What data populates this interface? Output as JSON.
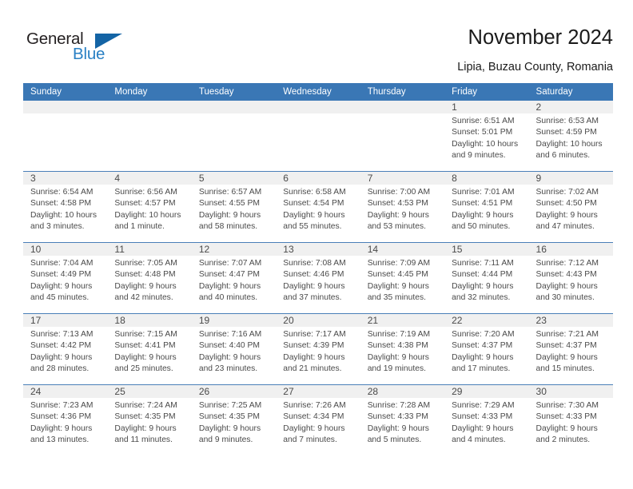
{
  "logo": {
    "word1": "General",
    "word2": "Blue",
    "flag_icon": "triangle-flag-icon",
    "accent_color": "#1464a5",
    "text_color": "#2980c4"
  },
  "header": {
    "title": "November 2024",
    "subtitle": "Lipia, Buzau County, Romania"
  },
  "calendar": {
    "header_bg": "#3a77b5",
    "header_text_color": "#ffffff",
    "datestrip_bg": "#f0f0f0",
    "cell_bg": "#ffffff",
    "grid_line_color": "#4a7fb8",
    "weekdays": [
      "Sunday",
      "Monday",
      "Tuesday",
      "Wednesday",
      "Thursday",
      "Friday",
      "Saturday"
    ],
    "weeks": [
      [
        {
          "day": "",
          "lines": []
        },
        {
          "day": "",
          "lines": []
        },
        {
          "day": "",
          "lines": []
        },
        {
          "day": "",
          "lines": []
        },
        {
          "day": "",
          "lines": []
        },
        {
          "day": "1",
          "lines": [
            "Sunrise: 6:51 AM",
            "Sunset: 5:01 PM",
            "Daylight: 10 hours",
            "and 9 minutes."
          ]
        },
        {
          "day": "2",
          "lines": [
            "Sunrise: 6:53 AM",
            "Sunset: 4:59 PM",
            "Daylight: 10 hours",
            "and 6 minutes."
          ]
        }
      ],
      [
        {
          "day": "3",
          "lines": [
            "Sunrise: 6:54 AM",
            "Sunset: 4:58 PM",
            "Daylight: 10 hours",
            "and 3 minutes."
          ]
        },
        {
          "day": "4",
          "lines": [
            "Sunrise: 6:56 AM",
            "Sunset: 4:57 PM",
            "Daylight: 10 hours",
            "and 1 minute."
          ]
        },
        {
          "day": "5",
          "lines": [
            "Sunrise: 6:57 AM",
            "Sunset: 4:55 PM",
            "Daylight: 9 hours",
            "and 58 minutes."
          ]
        },
        {
          "day": "6",
          "lines": [
            "Sunrise: 6:58 AM",
            "Sunset: 4:54 PM",
            "Daylight: 9 hours",
            "and 55 minutes."
          ]
        },
        {
          "day": "7",
          "lines": [
            "Sunrise: 7:00 AM",
            "Sunset: 4:53 PM",
            "Daylight: 9 hours",
            "and 53 minutes."
          ]
        },
        {
          "day": "8",
          "lines": [
            "Sunrise: 7:01 AM",
            "Sunset: 4:51 PM",
            "Daylight: 9 hours",
            "and 50 minutes."
          ]
        },
        {
          "day": "9",
          "lines": [
            "Sunrise: 7:02 AM",
            "Sunset: 4:50 PM",
            "Daylight: 9 hours",
            "and 47 minutes."
          ]
        }
      ],
      [
        {
          "day": "10",
          "lines": [
            "Sunrise: 7:04 AM",
            "Sunset: 4:49 PM",
            "Daylight: 9 hours",
            "and 45 minutes."
          ]
        },
        {
          "day": "11",
          "lines": [
            "Sunrise: 7:05 AM",
            "Sunset: 4:48 PM",
            "Daylight: 9 hours",
            "and 42 minutes."
          ]
        },
        {
          "day": "12",
          "lines": [
            "Sunrise: 7:07 AM",
            "Sunset: 4:47 PM",
            "Daylight: 9 hours",
            "and 40 minutes."
          ]
        },
        {
          "day": "13",
          "lines": [
            "Sunrise: 7:08 AM",
            "Sunset: 4:46 PM",
            "Daylight: 9 hours",
            "and 37 minutes."
          ]
        },
        {
          "day": "14",
          "lines": [
            "Sunrise: 7:09 AM",
            "Sunset: 4:45 PM",
            "Daylight: 9 hours",
            "and 35 minutes."
          ]
        },
        {
          "day": "15",
          "lines": [
            "Sunrise: 7:11 AM",
            "Sunset: 4:44 PM",
            "Daylight: 9 hours",
            "and 32 minutes."
          ]
        },
        {
          "day": "16",
          "lines": [
            "Sunrise: 7:12 AM",
            "Sunset: 4:43 PM",
            "Daylight: 9 hours",
            "and 30 minutes."
          ]
        }
      ],
      [
        {
          "day": "17",
          "lines": [
            "Sunrise: 7:13 AM",
            "Sunset: 4:42 PM",
            "Daylight: 9 hours",
            "and 28 minutes."
          ]
        },
        {
          "day": "18",
          "lines": [
            "Sunrise: 7:15 AM",
            "Sunset: 4:41 PM",
            "Daylight: 9 hours",
            "and 25 minutes."
          ]
        },
        {
          "day": "19",
          "lines": [
            "Sunrise: 7:16 AM",
            "Sunset: 4:40 PM",
            "Daylight: 9 hours",
            "and 23 minutes."
          ]
        },
        {
          "day": "20",
          "lines": [
            "Sunrise: 7:17 AM",
            "Sunset: 4:39 PM",
            "Daylight: 9 hours",
            "and 21 minutes."
          ]
        },
        {
          "day": "21",
          "lines": [
            "Sunrise: 7:19 AM",
            "Sunset: 4:38 PM",
            "Daylight: 9 hours",
            "and 19 minutes."
          ]
        },
        {
          "day": "22",
          "lines": [
            "Sunrise: 7:20 AM",
            "Sunset: 4:37 PM",
            "Daylight: 9 hours",
            "and 17 minutes."
          ]
        },
        {
          "day": "23",
          "lines": [
            "Sunrise: 7:21 AM",
            "Sunset: 4:37 PM",
            "Daylight: 9 hours",
            "and 15 minutes."
          ]
        }
      ],
      [
        {
          "day": "24",
          "lines": [
            "Sunrise: 7:23 AM",
            "Sunset: 4:36 PM",
            "Daylight: 9 hours",
            "and 13 minutes."
          ]
        },
        {
          "day": "25",
          "lines": [
            "Sunrise: 7:24 AM",
            "Sunset: 4:35 PM",
            "Daylight: 9 hours",
            "and 11 minutes."
          ]
        },
        {
          "day": "26",
          "lines": [
            "Sunrise: 7:25 AM",
            "Sunset: 4:35 PM",
            "Daylight: 9 hours",
            "and 9 minutes."
          ]
        },
        {
          "day": "27",
          "lines": [
            "Sunrise: 7:26 AM",
            "Sunset: 4:34 PM",
            "Daylight: 9 hours",
            "and 7 minutes."
          ]
        },
        {
          "day": "28",
          "lines": [
            "Sunrise: 7:28 AM",
            "Sunset: 4:33 PM",
            "Daylight: 9 hours",
            "and 5 minutes."
          ]
        },
        {
          "day": "29",
          "lines": [
            "Sunrise: 7:29 AM",
            "Sunset: 4:33 PM",
            "Daylight: 9 hours",
            "and 4 minutes."
          ]
        },
        {
          "day": "30",
          "lines": [
            "Sunrise: 7:30 AM",
            "Sunset: 4:33 PM",
            "Daylight: 9 hours",
            "and 2 minutes."
          ]
        }
      ]
    ]
  }
}
